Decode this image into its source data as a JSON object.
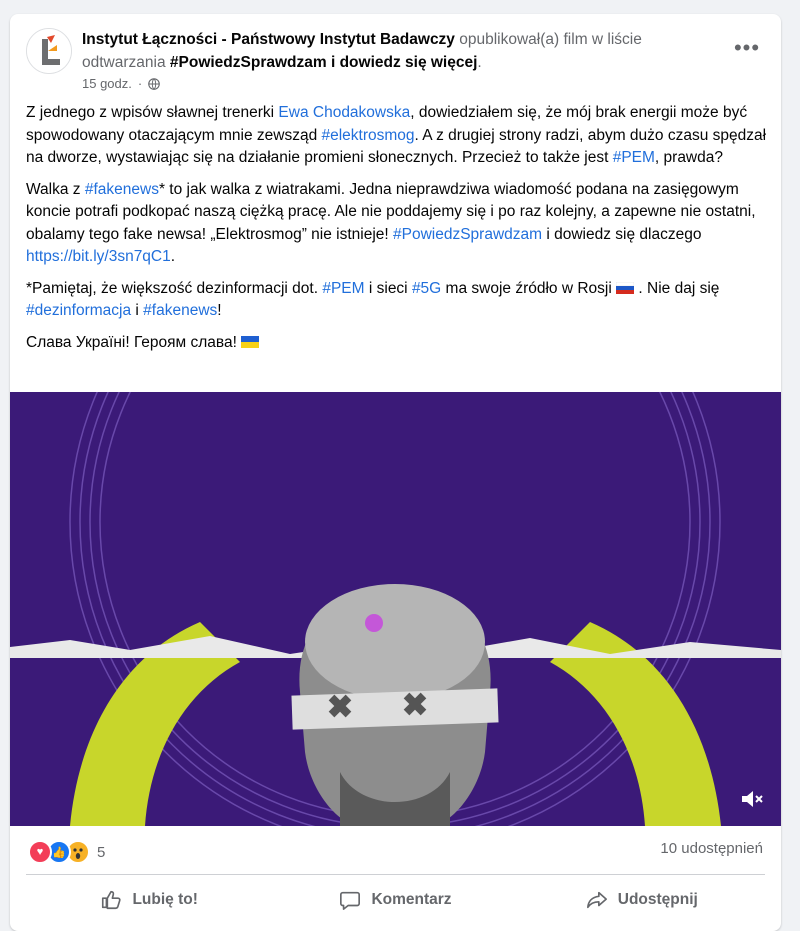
{
  "post": {
    "author": "Instytut Łączności - Państwowy Instytut Badawczy",
    "verb": "opublikował(a) film w liście odtwarzania",
    "playlist": "#PowiedzSprawdzam i dowiedz się więcej",
    "period": ".",
    "time": "15 godz.",
    "time_sep": "·",
    "more_label": "•••",
    "icons": {
      "avatar": "institute-logo-icon",
      "privacy": "globe-icon",
      "more": "more-options-icon"
    }
  },
  "text": {
    "p1": {
      "a": "Z jednego z wpisów sławnej trenerki ",
      "link1": "Ewa Chodakowska",
      "b": ", dowiedziałem się, że mój brak energii może być spowodowany otaczającym mnie zewsząd ",
      "tag1": "#elektrosmog",
      "c": ". A z drugiej strony radzi, abym dużo czasu spędzał na dworze, wystawiając się na działanie promieni słonecznych. Przecież to także jest ",
      "tag2": "#PEM",
      "d": ", prawda?"
    },
    "p2": {
      "a": "Walka z ",
      "tag1": "#fakenews",
      "b": "* to jak walka z wiatrakami. Jedna nieprawdziwa wiadomość podana na zasięgowym koncie potrafi podkopać naszą ciężką pracę. Ale nie poddajemy się i po raz kolejny, a zapewne nie ostatni, obalamy tego fake newsa! „Elektrosmog” nie istnieje! ",
      "tag2": "#PowiedzSprawdzam",
      "c": " i dowiedz się dlaczego  ",
      "url": "https://bit.ly/3sn7qC1",
      "d": "."
    },
    "p3": {
      "a": "*Pamiętaj, że większość dezinformacji dot. ",
      "tag1": "#PEM",
      "b": " i sieci ",
      "tag2": "#5G",
      "c": " ma swoje źródło w Rosji ",
      "d": " . Nie daj się ",
      "tag3": "#dezinformacja",
      "e": " i ",
      "tag4": "#fakenews",
      "f": "!"
    },
    "p4": "Слава Україні! Героям слава! ",
    "flags": {
      "russia": "russia-flag-icon",
      "ukraine": "ukraine-flag-icon"
    }
  },
  "media": {
    "colors": {
      "background": "#3b1a78",
      "ring": "#c8d62b",
      "dot": "#c457d8"
    },
    "mute_icon": "muted-speaker-icon"
  },
  "stats": {
    "reaction_icons": [
      "love-reaction-icon",
      "like-reaction-icon",
      "wow-reaction-icon"
    ],
    "reaction_count": "5",
    "shares": "10 udostępnień"
  },
  "actions": {
    "like": "Lubię to!",
    "comment": "Komentarz",
    "share": "Udostępnij"
  }
}
